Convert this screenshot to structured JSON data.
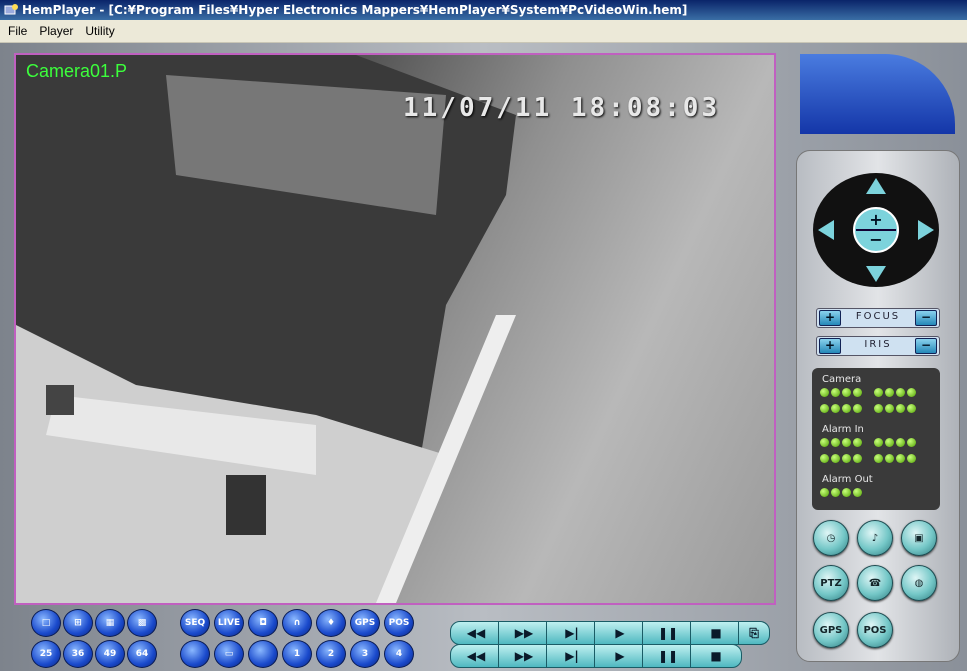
{
  "window": {
    "title": "HemPlayer - [C:¥Program Files¥Hyper Electronics Mappers¥HemPlayer¥System¥PcVideoWin.hem]"
  },
  "menu": {
    "items": [
      "File",
      "Player",
      "Utility"
    ]
  },
  "video": {
    "camera_label": "Camera01.P",
    "timestamp": "11/07/11  18:08:03"
  },
  "ptz": {
    "focus_label": "FOCUS",
    "iris_label": "IRIS",
    "plus": "+",
    "minus": "−"
  },
  "status": {
    "camera_label": "Camera",
    "alarm_in_label": "Alarm In",
    "alarm_out_label": "Alarm Out"
  },
  "side_buttons": {
    "ptz": "PTZ",
    "gps": "GPS",
    "pos": "POS"
  },
  "bottom_buttons": {
    "seq": "SEQ",
    "live": "LIVE",
    "gps": "GPS",
    "pos": "POS",
    "ch25": "25",
    "ch36": "36",
    "ch49": "49",
    "ch64": "64",
    "dvr1": "1",
    "dvr2": "2",
    "dvr3": "3",
    "dvr4": "4",
    "dvr": "DVR"
  },
  "colors": {
    "accent_blue": "#1a4acc",
    "panel_teal": "#74c7c7",
    "led_green": "#4fa000"
  }
}
